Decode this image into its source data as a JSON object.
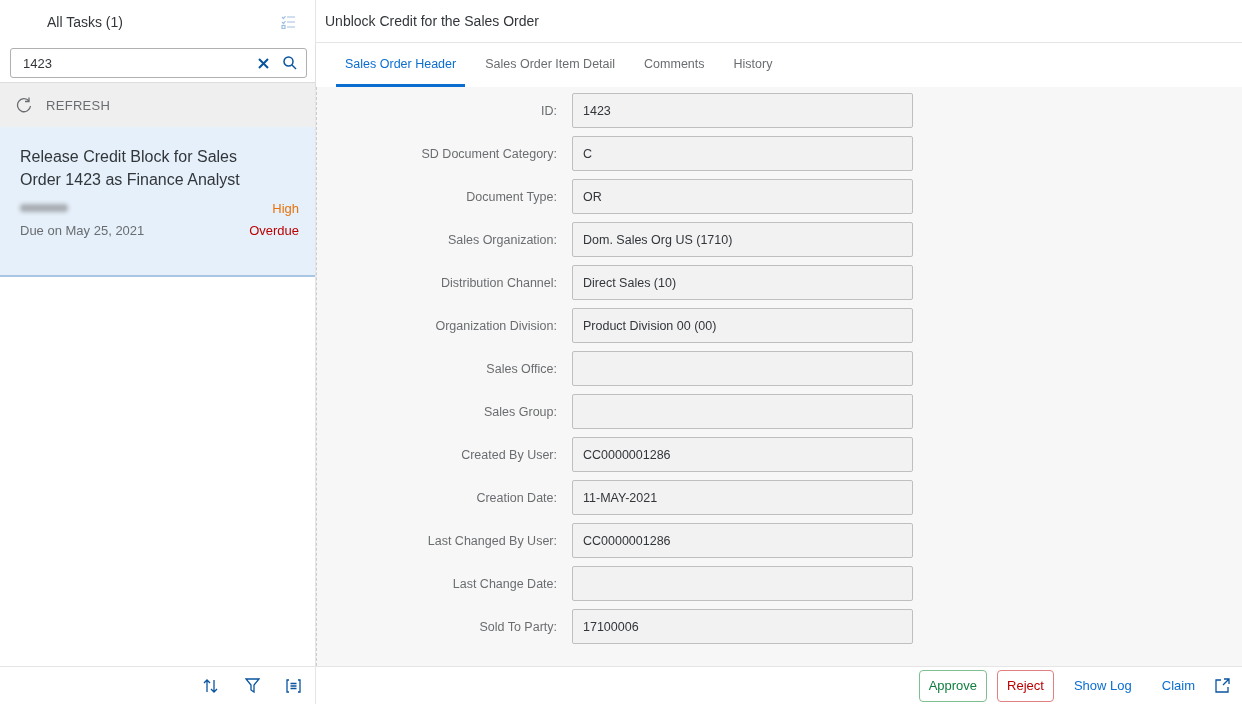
{
  "master": {
    "title": "All Tasks (1)",
    "search": {
      "value": "1423"
    },
    "refresh": "REFRESH",
    "tasks": [
      {
        "title": "Release Credit Block for Sales Order 1423 as Finance Analyst",
        "priority": "High",
        "due": "Due on May 25, 2021",
        "status": "Overdue",
        "selected": true
      }
    ]
  },
  "detail": {
    "title": "Unblock Credit for the Sales Order",
    "tabs": [
      {
        "label": "Sales Order Header",
        "selected": true
      },
      {
        "label": "Sales Order Item Detail",
        "selected": false
      },
      {
        "label": "Comments",
        "selected": false
      },
      {
        "label": "History",
        "selected": false
      }
    ],
    "fields": [
      {
        "label": "ID:",
        "value": "1423"
      },
      {
        "label": "SD Document Category:",
        "value": "C"
      },
      {
        "label": "Document Type:",
        "value": "OR"
      },
      {
        "label": "Sales Organization:",
        "value": "Dom. Sales Org US (1710)"
      },
      {
        "label": "Distribution Channel:",
        "value": "Direct Sales (10)"
      },
      {
        "label": "Organization Division:",
        "value": "Product Division 00 (00)"
      },
      {
        "label": "Sales Office:"
      },
      {
        "label": "Sales Group:"
      },
      {
        "label": "Created By User:",
        "value": "CC0000001286"
      },
      {
        "label": "Creation Date:",
        "value": "11-MAY-2021"
      },
      {
        "label": "Last Changed By User:",
        "value": "CC0000001286"
      },
      {
        "label": "Last Change Date:"
      },
      {
        "label": "Sold To Party:",
        "value": "17100006"
      }
    ],
    "actions": [
      {
        "kind": "approve",
        "label": "Approve"
      },
      {
        "kind": "reject",
        "label": "Reject"
      },
      {
        "kind": "link",
        "label": "Show Log"
      },
      {
        "kind": "link",
        "label": "Claim"
      }
    ]
  }
}
